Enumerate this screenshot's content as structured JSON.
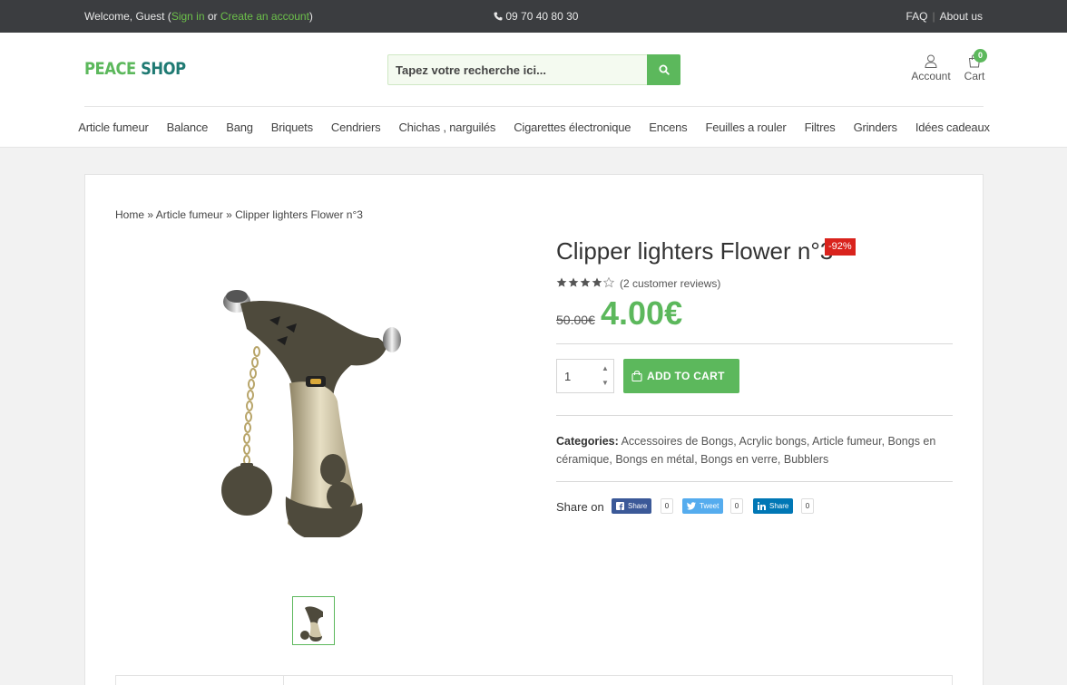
{
  "topbar": {
    "welcome_prefix": "Welcome, Guest (",
    "sign_in": "Sign in",
    "or": " or ",
    "create_account": "Create an account",
    "welcome_suffix": ")",
    "phone": "09 70 40 80 30",
    "faq": "FAQ",
    "about": "About us"
  },
  "header": {
    "logo_part1": "PEACE",
    "logo_part2": "SHOP",
    "search_placeholder": "Tapez votre recherche ici...",
    "account_label": "Account",
    "cart_label": "Cart",
    "cart_count": "0"
  },
  "nav": {
    "items": [
      "Article fumeur",
      "Balance",
      "Bang",
      "Briquets",
      "Cendriers",
      "Chichas , narguilés",
      "Cigarettes électronique",
      "Encens",
      "Feuilles a rouler",
      "Filtres",
      "Grinders",
      "Idées cadeaux"
    ]
  },
  "breadcrumb": {
    "home": "Home",
    "sep": " » ",
    "category": "Article fumeur",
    "current": "Clipper lighters Flower n°3"
  },
  "product": {
    "title": "Clipper lighters Flower n°3",
    "discount_badge": "-92%",
    "rating": 4,
    "rating_max": 5,
    "reviews": "(2 customer reviews)",
    "old_price": "50.00€",
    "price": "4.00€",
    "quantity": "1",
    "add_to_cart": "ADD TO CART",
    "categories_label": "Categories:",
    "categories": [
      "Accessoires de Bongs",
      "Acrylic bongs",
      "Article fumeur",
      "Bongs en céramique",
      "Bongs en métal",
      "Bongs en verre",
      "Bubblers"
    ]
  },
  "share": {
    "label": "Share on",
    "facebook": {
      "label": "Share",
      "count": "0",
      "color": "#3b5998"
    },
    "twitter": {
      "label": "Tweet",
      "count": "0",
      "color": "#55acee"
    },
    "linkedin": {
      "label": "Share",
      "count": "0",
      "color": "#0077b5"
    }
  },
  "colors": {
    "accent": "#5cb85c",
    "badge": "#d9231d",
    "topbar": "#3b3d40"
  }
}
